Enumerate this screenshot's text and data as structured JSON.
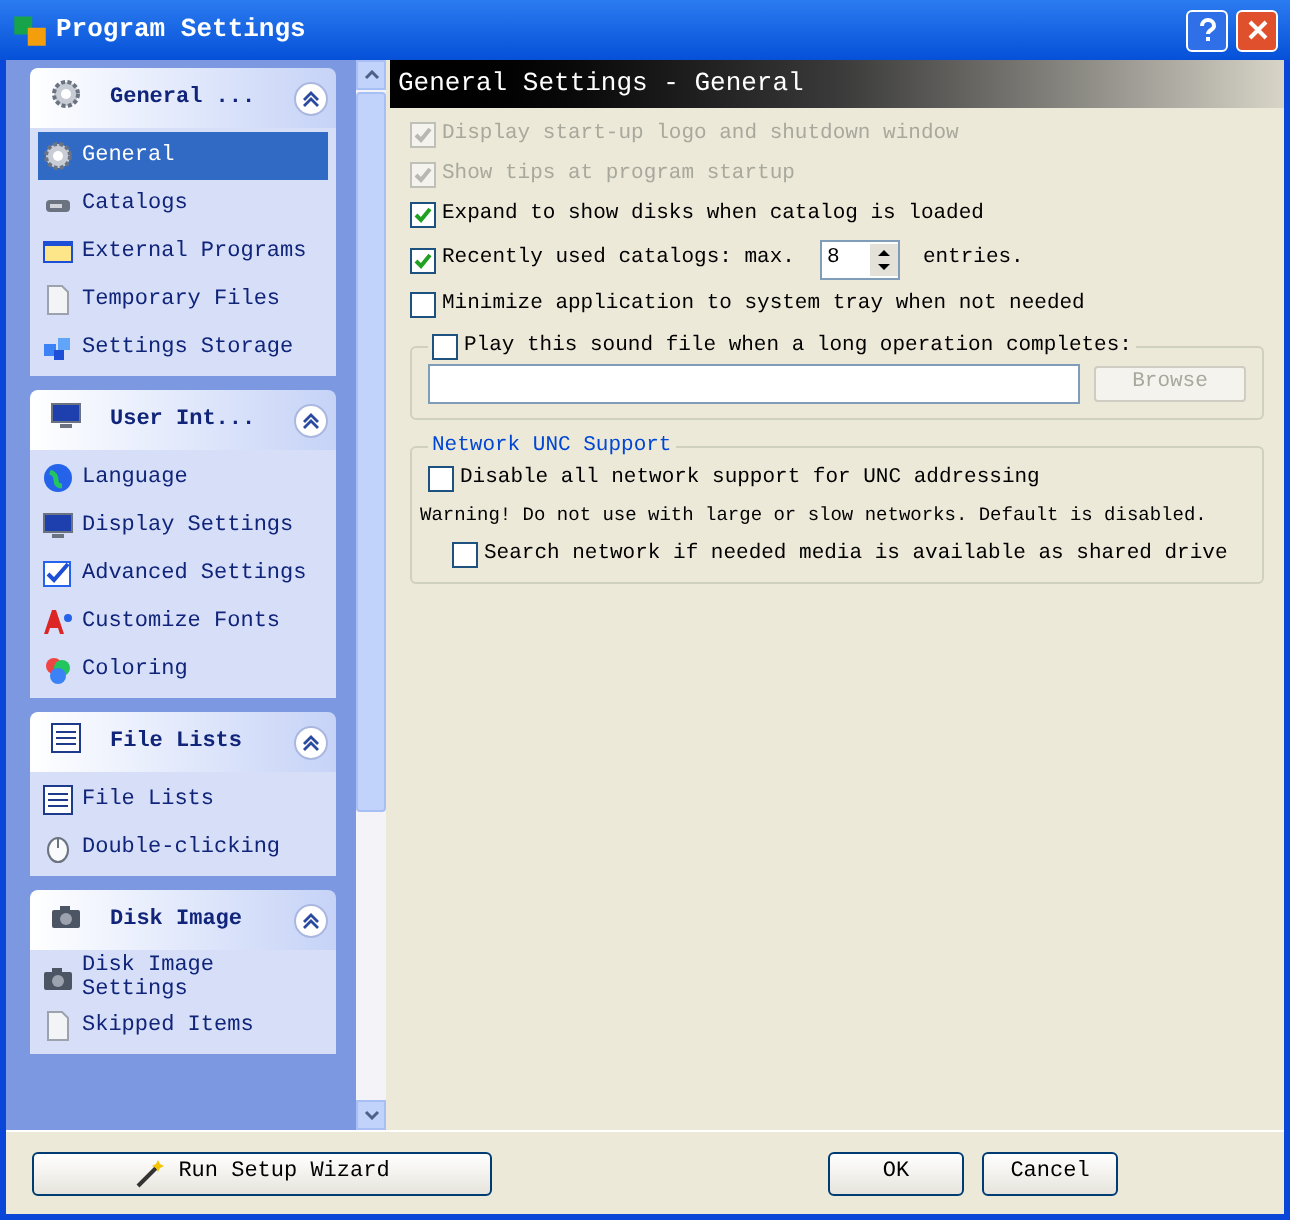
{
  "window": {
    "title": "Program Settings"
  },
  "sidebar": {
    "groups": [
      {
        "title": "General ...",
        "expanded": true,
        "items": [
          {
            "label": "General",
            "selected": true
          },
          {
            "label": "Catalogs",
            "selected": false
          },
          {
            "label": "External Programs",
            "selected": false
          },
          {
            "label": "Temporary Files",
            "selected": false
          },
          {
            "label": "Settings Storage",
            "selected": false
          }
        ]
      },
      {
        "title": "User Int...",
        "expanded": true,
        "items": [
          {
            "label": "Language",
            "selected": false
          },
          {
            "label": "Display Settings",
            "selected": false
          },
          {
            "label": "Advanced Settings",
            "selected": false
          },
          {
            "label": "Customize Fonts",
            "selected": false
          },
          {
            "label": "Coloring",
            "selected": false
          }
        ]
      },
      {
        "title": "File Lists",
        "expanded": true,
        "items": [
          {
            "label": "File Lists",
            "selected": false
          },
          {
            "label": "Double-clicking",
            "selected": false
          }
        ]
      },
      {
        "title": "Disk Image",
        "expanded": true,
        "items": [
          {
            "label": "Disk Image Settings",
            "selected": false
          },
          {
            "label": "Skipped Items",
            "selected": false
          }
        ]
      }
    ]
  },
  "panel": {
    "title": "General Settings - General",
    "options": [
      {
        "kind": "checkbox",
        "label": "Display start-up logo and shutdown window",
        "checked": true,
        "disabled": true
      },
      {
        "kind": "checkbox",
        "label": "Show tips at program startup",
        "checked": true,
        "disabled": true
      },
      {
        "kind": "checkbox",
        "label": "Expand to show disks when catalog is loaded",
        "checked": true,
        "disabled": false
      },
      {
        "kind": "spin",
        "label": "Recently used catalogs: max.",
        "checked": true,
        "disabled": false,
        "value": "8",
        "suffix": "entries."
      },
      {
        "kind": "checkbox",
        "label": "Minimize application to system tray when not needed",
        "checked": false,
        "disabled": false
      }
    ],
    "sound": {
      "label": "Play this sound file when a long operation completes:",
      "checked": false,
      "browse": {
        "label": "Browse",
        "disabled": true
      }
    },
    "network": {
      "title": "Network UNC Support",
      "disable_option": {
        "label": "Disable all network support for UNC addressing",
        "checked": false
      },
      "warning": "Warning! Do not use with large or slow networks. Default is disabled.",
      "search_option": {
        "label": "Search network if needed media is available as shared drive",
        "checked": false
      }
    }
  },
  "buttons": {
    "wizard": "Run Setup Wizard",
    "ok": "OK",
    "cancel": "Cancel"
  }
}
